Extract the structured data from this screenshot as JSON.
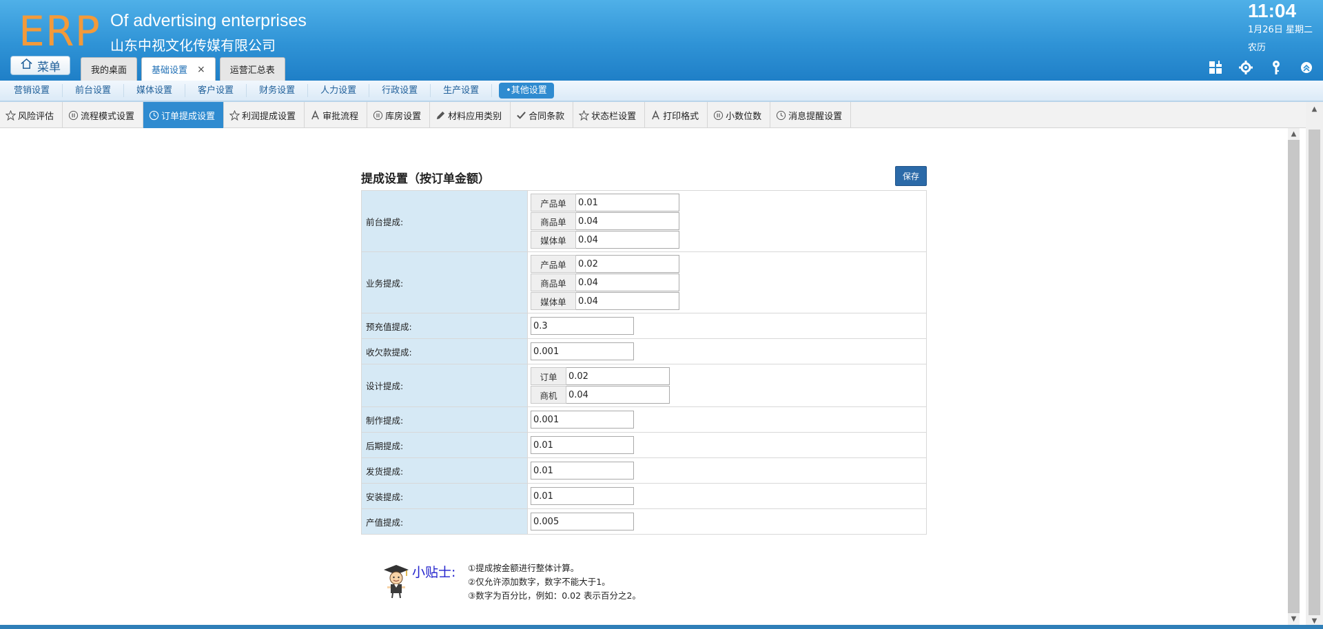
{
  "header": {
    "logo": "ERP",
    "company_en": "Of advertising enterprises",
    "company_cn": "山东中视文化传媒有限公司",
    "time": "11:04",
    "date": "1月26日 星期二",
    "lunar": "农历",
    "menu_label": "菜单",
    "tabs": [
      {
        "label": "我的桌面"
      },
      {
        "label": "基础设置",
        "close": "×"
      },
      {
        "label": "运营汇总表"
      }
    ],
    "icons": [
      "grid-icon",
      "gear-icon",
      "key-icon",
      "chevron-up-icon"
    ]
  },
  "nav2": {
    "items": [
      "营销设置",
      "前台设置",
      "媒体设置",
      "客户设置",
      "财务设置",
      "人力设置",
      "行政设置",
      "生产设置"
    ],
    "active": "•其他设置"
  },
  "nav3": {
    "items": [
      {
        "label": "风险评估",
        "icon": "star-icon"
      },
      {
        "label": "流程模式设置",
        "icon": "pause-circle-icon"
      },
      {
        "label": "订单提成设置",
        "icon": "clock-icon"
      },
      {
        "label": "利润提成设置",
        "icon": "star-icon"
      },
      {
        "label": "审批流程",
        "icon": "letter-a-icon"
      },
      {
        "label": "库房设置",
        "icon": "pause-circle-icon"
      },
      {
        "label": "材料应用类别",
        "icon": "pencil-icon"
      },
      {
        "label": "合同条款",
        "icon": "check-icon"
      },
      {
        "label": "状态栏设置",
        "icon": "star-icon"
      },
      {
        "label": "打印格式",
        "icon": "letter-a-icon"
      },
      {
        "label": "小数位数",
        "icon": "pause-circle-icon"
      },
      {
        "label": "消息提醒设置",
        "icon": "clock-icon"
      }
    ],
    "active_index": 2
  },
  "section": {
    "title": "提成设置（按订单金额）",
    "save_label": "保存"
  },
  "rows": [
    {
      "label": "前台提成:",
      "subs": [
        {
          "addon": "产品单",
          "value": "0.01"
        },
        {
          "addon": "商品单",
          "value": "0.04"
        },
        {
          "addon": "媒体单",
          "value": "0.04"
        }
      ]
    },
    {
      "label": "业务提成:",
      "subs": [
        {
          "addon": "产品单",
          "value": "0.02"
        },
        {
          "addon": "商品单",
          "value": "0.04"
        },
        {
          "addon": "媒体单",
          "value": "0.04"
        }
      ]
    },
    {
      "label": "预充值提成:",
      "value": "0.3"
    },
    {
      "label": "收欠款提成:",
      "value": "0.001"
    },
    {
      "label": "设计提成:",
      "subs": [
        {
          "addon": "订单",
          "value": "0.02"
        },
        {
          "addon": "商机",
          "value": "0.04"
        }
      ]
    },
    {
      "label": "制作提成:",
      "value": "0.001"
    },
    {
      "label": "后期提成:",
      "value": "0.01"
    },
    {
      "label": "发货提成:",
      "value": "0.01"
    },
    {
      "label": "安装提成:",
      "value": "0.01"
    },
    {
      "label": "产值提成:",
      "value": "0.005"
    }
  ],
  "tips": {
    "title": "小贴士:",
    "lines": [
      "①提成按金额进行整体计算。",
      "②仅允许添加数字，数字不能大于1。",
      "③数字为百分比，例如：0.02 表示百分之2。"
    ]
  },
  "colors": {
    "header_blue": "#2f93d6",
    "logo_orange": "#f39a3a",
    "active_tab_blue": "#2f8bd0",
    "label_cell_bg": "#d6e9f5",
    "save_button": "#2b6aa8",
    "tips_title": "#2222cc"
  }
}
